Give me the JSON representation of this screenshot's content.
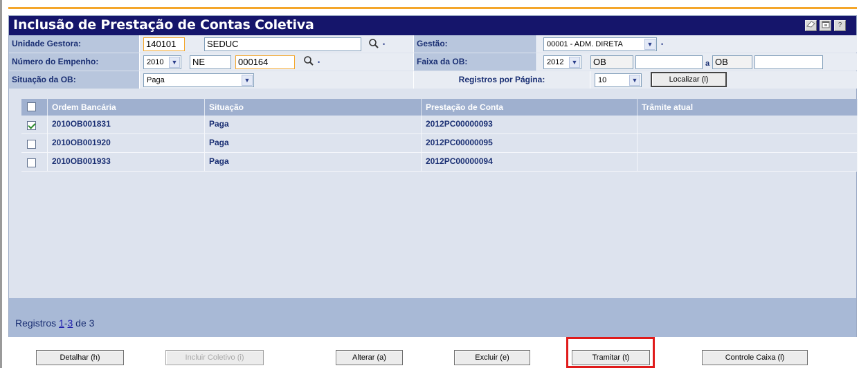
{
  "title": "Inclusão de Prestação de Contas Coletiva",
  "titlebar_icons": [
    "eraser-icon",
    "window-icon",
    "help-icon"
  ],
  "help_glyph": "?",
  "form": {
    "unidade_label": "Unidade Gestora:",
    "unidade_code": "140101",
    "unidade_name": "SEDUC",
    "gestao_label": "Gestão:",
    "gestao_value": "00001 - ADM. DIRETA",
    "empenho_label": "Número do Empenho:",
    "empenho_year": "2010",
    "empenho_type": "NE",
    "empenho_number": "000164",
    "faixa_label": "Faixa da OB:",
    "faixa_year": "2012",
    "faixa_from_prefix": "OB",
    "faixa_from_value": "",
    "faixa_sep": "a",
    "faixa_to_prefix": "OB",
    "faixa_to_value": "",
    "situacao_label": "Situação da OB:",
    "situacao_value": "Paga",
    "registros_label": "Registros por Página:",
    "registros_value": "10",
    "localizar_label": "Localizar (l)",
    "required_mark": "•",
    "arrow": "▼"
  },
  "grid": {
    "columns": [
      "Ordem Bancária",
      "Situação",
      "Prestação de Conta",
      "Trâmite atual"
    ],
    "rows": [
      {
        "checked": true,
        "ordem": "2010OB001831",
        "situacao": "Paga",
        "prestacao": "2012PC00000093",
        "tramite": ""
      },
      {
        "checked": false,
        "ordem": "2010OB001920",
        "situacao": "Paga",
        "prestacao": "2012PC00000095",
        "tramite": ""
      },
      {
        "checked": false,
        "ordem": "2010OB001933",
        "situacao": "Paga",
        "prestacao": "2012PC00000094",
        "tramite": ""
      }
    ]
  },
  "footer": {
    "prefix": "Registros ",
    "range_start": "1",
    "range_dash": "-",
    "range_end": "3",
    "suffix": " de 3"
  },
  "buttons": {
    "detalhar": "Detalhar (h)",
    "incluir": "Incluir Coletivo (i)",
    "alterar": "Alterar (a)",
    "excluir": "Excluir (e)",
    "tramitar": "Tramitar (t)",
    "controle": "Controle Caixa (l)"
  },
  "colors": {
    "title_bg": "#15156b",
    "accent_orange": "#f4a62a",
    "highlight_red": "#e01b1b"
  }
}
